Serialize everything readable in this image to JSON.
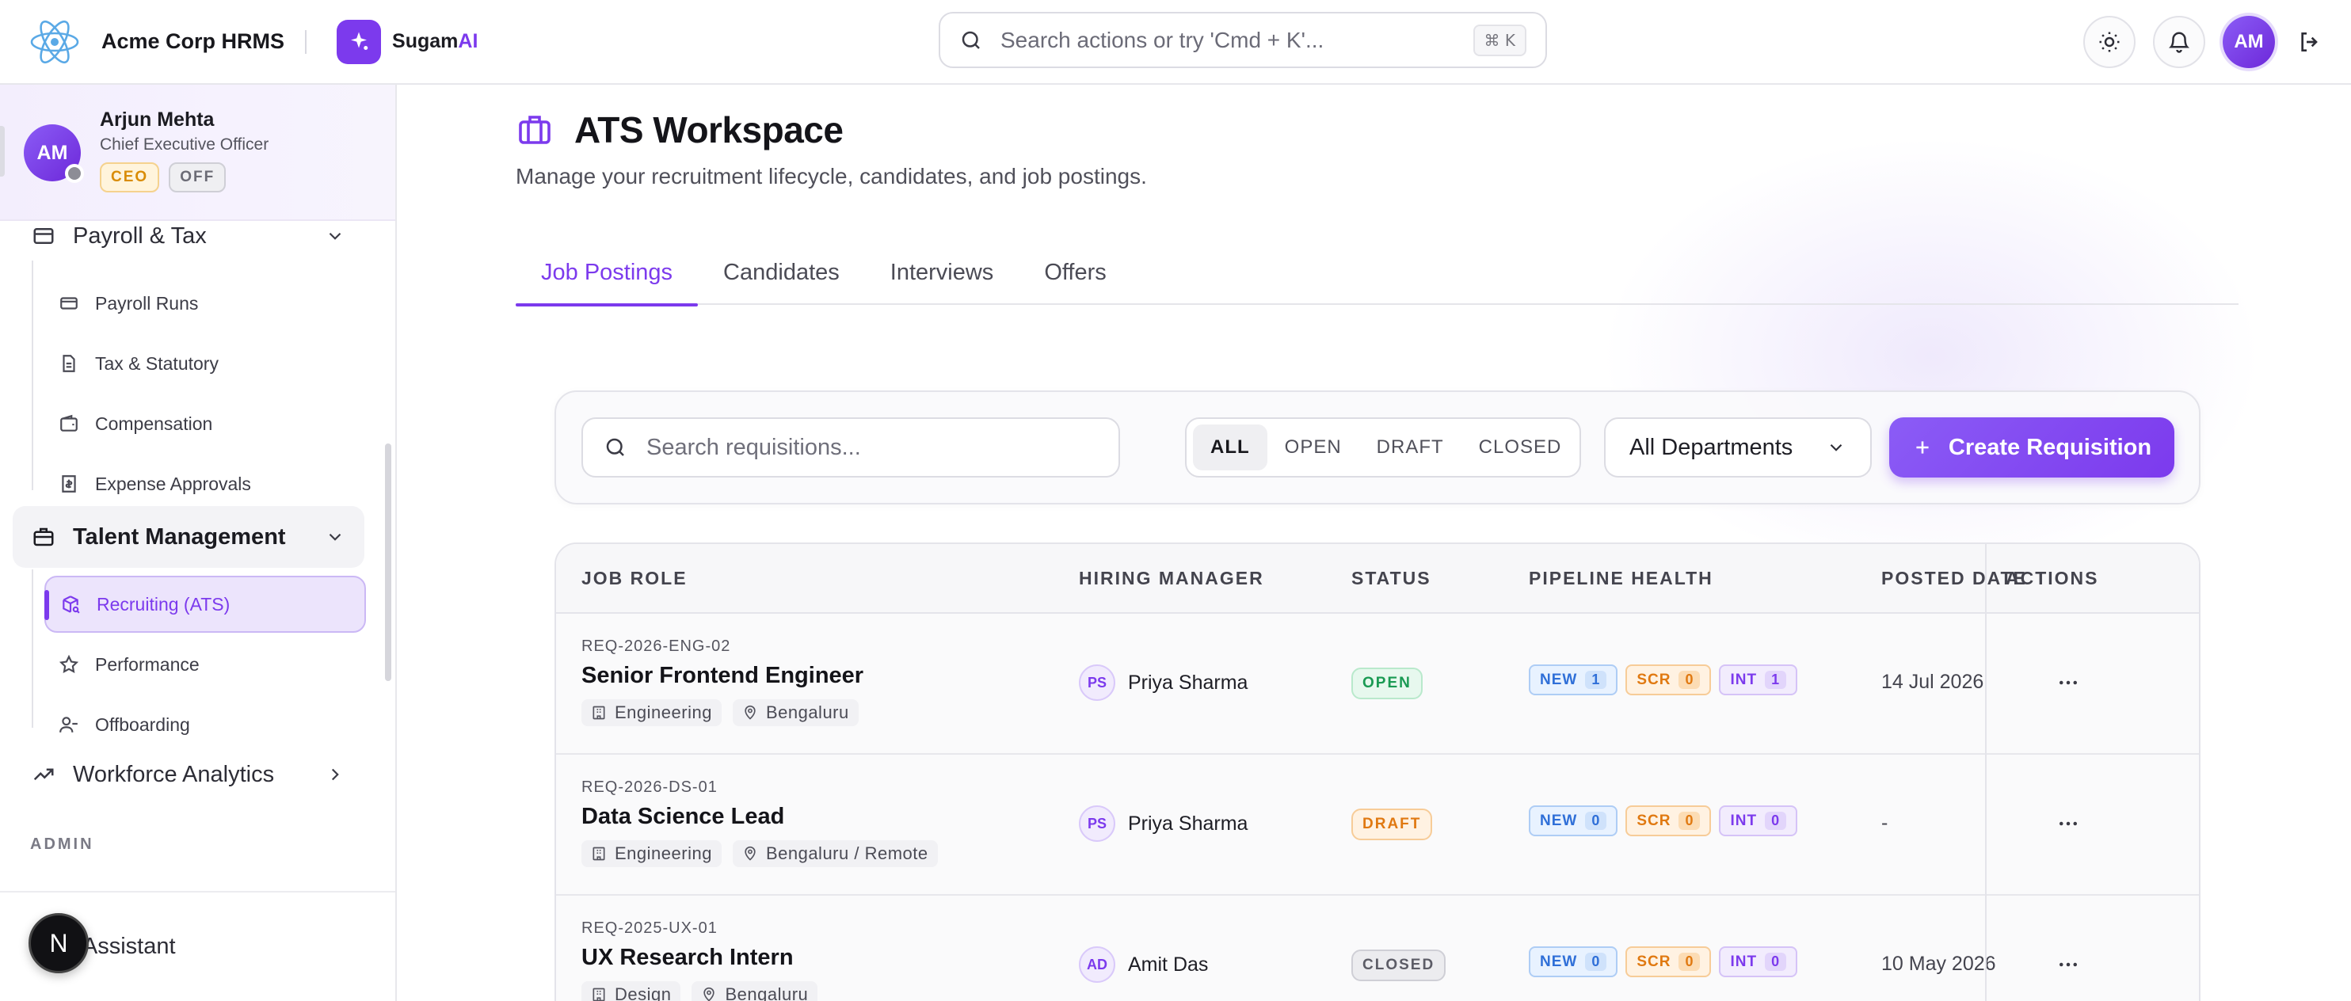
{
  "app": {
    "title": "Acme Corp HRMS",
    "assistant_prefix": "Sugam",
    "assistant_suffix": "AI"
  },
  "command_search": {
    "placeholder": "Search actions or try 'Cmd + K'...",
    "shortcut": "⌘ K"
  },
  "top_right": {
    "avatar_initials": "AM"
  },
  "user": {
    "name": "Arjun Mehta",
    "title": "Chief Executive Officer",
    "initials": "AM",
    "tags": [
      "CEO",
      "OFF"
    ]
  },
  "sidebar": {
    "payroll_group": "Payroll & Tax",
    "payroll_items": [
      "Payroll Runs",
      "Tax & Statutory",
      "Compensation",
      "Expense Approvals"
    ],
    "talent_group": "Talent Management",
    "talent_items": [
      "Recruiting (ATS)",
      "Performance",
      "Offboarding"
    ],
    "analytics_group": "Workforce Analytics",
    "admin_label": "ADMIN",
    "ai_assistant": "AI Assistant",
    "fab_letter": "N"
  },
  "page": {
    "title": "ATS Workspace",
    "subtitle": "Manage your recruitment lifecycle, candidates, and job postings.",
    "tabs": [
      "Job Postings",
      "Candidates",
      "Interviews",
      "Offers"
    ],
    "active_tab": "Job Postings"
  },
  "toolbar": {
    "search_placeholder": "Search requisitions...",
    "filters": [
      "ALL",
      "OPEN",
      "DRAFT",
      "CLOSED"
    ],
    "active_filter": "ALL",
    "department": "All Departments",
    "create_label": "Create Requisition"
  },
  "table": {
    "headers": [
      "JOB ROLE",
      "HIRING MANAGER",
      "STATUS",
      "PIPELINE HEALTH",
      "POSTED DATE",
      "ACTIONS"
    ],
    "rows": [
      {
        "req_id": "REQ-2026-ENG-02",
        "role": "Senior Frontend Engineer",
        "department": "Engineering",
        "location": "Bengaluru",
        "manager_initials": "PS",
        "manager": "Priya Sharma",
        "status": "OPEN",
        "new_label": "NEW",
        "new": "1",
        "scr_label": "SCR",
        "scr": "0",
        "int_label": "INT",
        "int": "1",
        "posted": "14 Jul 2026"
      },
      {
        "req_id": "REQ-2026-DS-01",
        "role": "Data Science Lead",
        "department": "Engineering",
        "location": "Bengaluru / Remote",
        "manager_initials": "PS",
        "manager": "Priya Sharma",
        "status": "DRAFT",
        "new_label": "NEW",
        "new": "0",
        "scr_label": "SCR",
        "scr": "0",
        "int_label": "INT",
        "int": "0",
        "posted": "-"
      },
      {
        "req_id": "REQ-2025-UX-01",
        "role": "UX Research Intern",
        "department": "Design",
        "location": "Bengaluru",
        "manager_initials": "AD",
        "manager": "Amit Das",
        "status": "CLOSED",
        "new_label": "NEW",
        "new": "0",
        "scr_label": "SCR",
        "scr": "0",
        "int_label": "INT",
        "int": "0",
        "posted": "10 May 2026"
      }
    ]
  },
  "colors": {
    "accent": "#7c3aed",
    "open": "#1a9a53",
    "draft": "#e07911",
    "closed": "#5c5c66"
  }
}
